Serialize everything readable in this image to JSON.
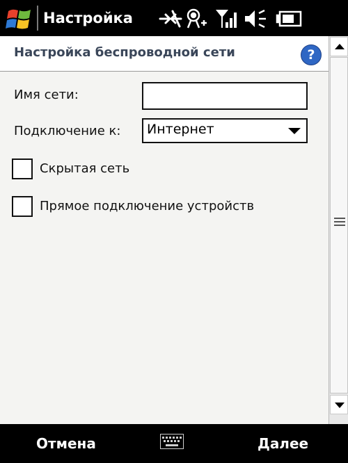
{
  "titlebar": {
    "app_title": "Настройка",
    "icons": [
      "windows-start-icon",
      "connectivity-icon",
      "gps-icon",
      "signal-strength-icon",
      "volume-icon",
      "battery-icon"
    ]
  },
  "header": {
    "title": "Настройка беспроводной сети",
    "help_label": "?",
    "help_color": "#2f67c4"
  },
  "form": {
    "network_name_label": "Имя сети:",
    "network_name_value": "",
    "connect_to_label": "Подключение к:",
    "connect_to_value": "Интернет",
    "hidden_network_label": "Скрытая сеть",
    "hidden_network_checked": false,
    "adhoc_label": "Прямое подключение устройств",
    "adhoc_checked": false
  },
  "softkeys": {
    "left": "Отмена",
    "right": "Далее",
    "center_icon": "keyboard-icon"
  }
}
